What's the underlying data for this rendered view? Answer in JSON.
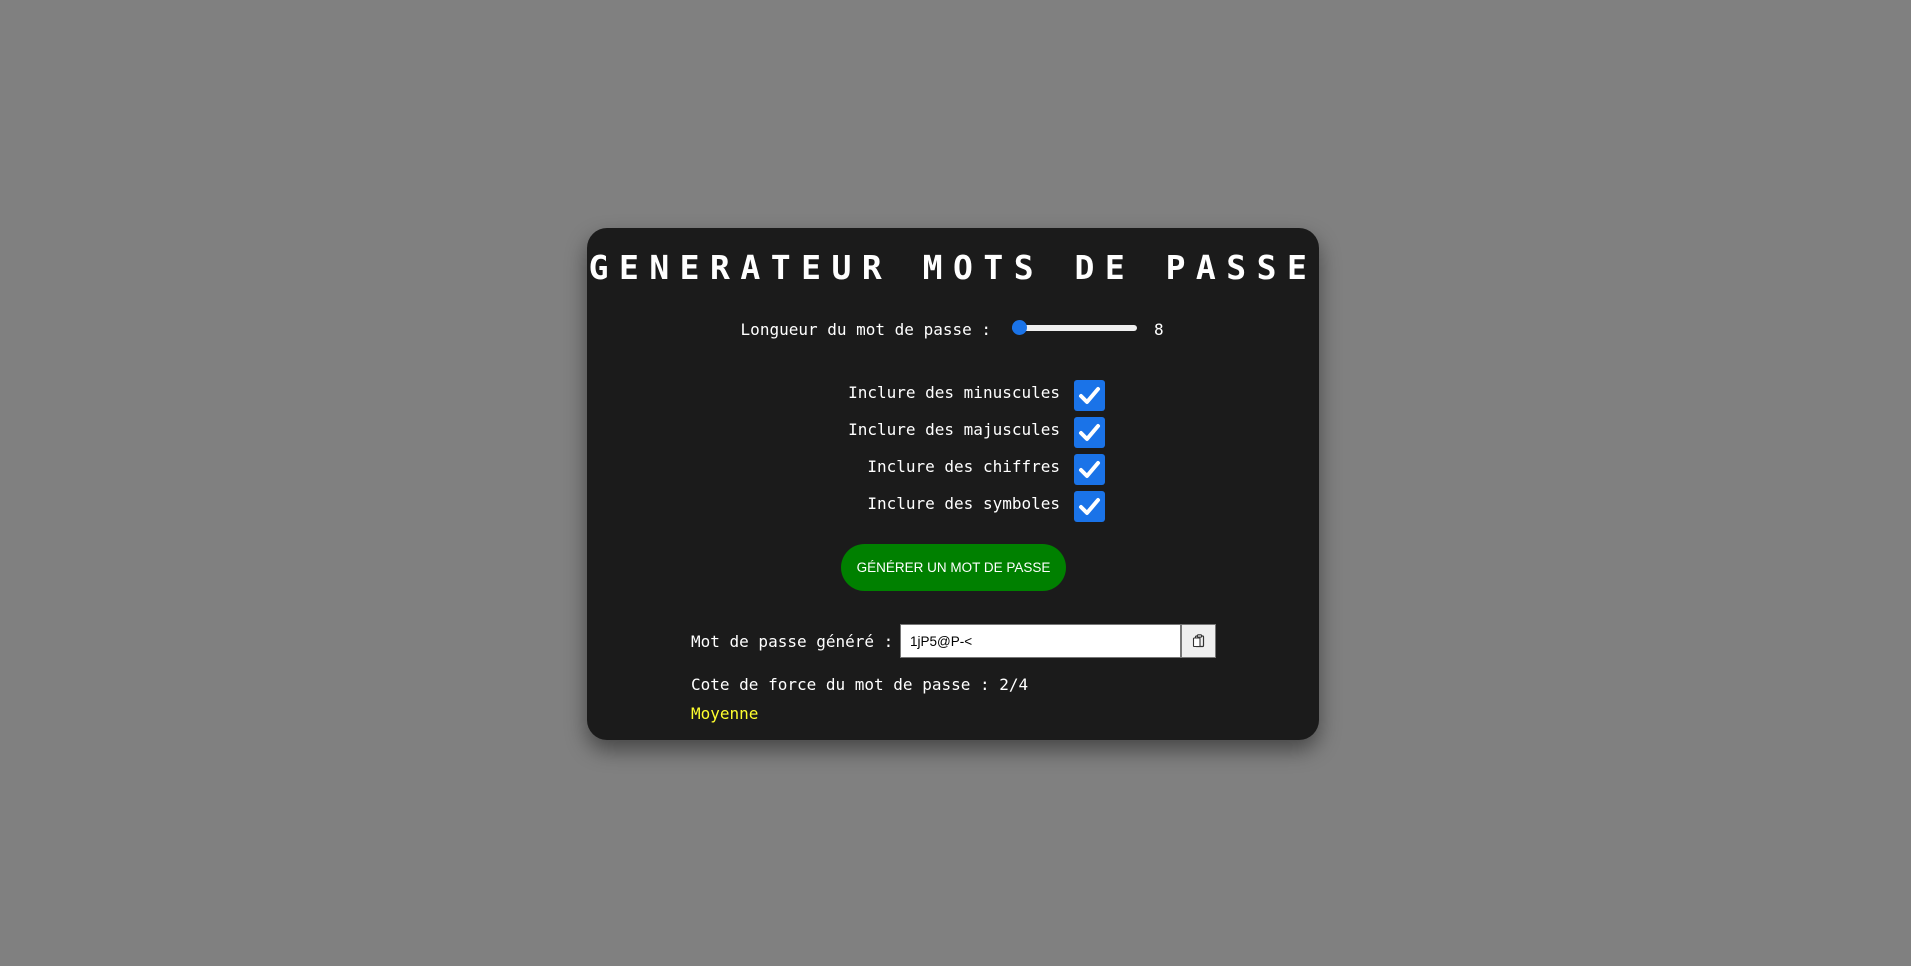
{
  "app": {
    "title": "GENERATEUR MOTS DE PASSE"
  },
  "length": {
    "label": "Longueur du mot de passe :",
    "value": "8",
    "min": 8,
    "max": 64,
    "current": 8
  },
  "options": [
    {
      "label": "Inclure des minuscules",
      "checked": true
    },
    {
      "label": "Inclure des majuscules",
      "checked": true
    },
    {
      "label": "Inclure des chiffres",
      "checked": true
    },
    {
      "label": "Inclure des symboles",
      "checked": true
    }
  ],
  "generate_button": {
    "label": "GÉNÉRER UN MOT DE PASSE"
  },
  "result": {
    "label": "Mot de passe généré :",
    "value": "1jP5@P-<",
    "copy_icon": "clipboard-icon"
  },
  "strength": {
    "label": "Cote de force du mot de passe : 2/4",
    "level_text": "Moyenne",
    "score": 2,
    "max_score": 4
  },
  "colors": {
    "page_background": "#808080",
    "card_background": "#1b1b1b",
    "accent_blue": "#1a73e8",
    "button_green": "#008000",
    "strength_yellow": "#ffff2e"
  }
}
